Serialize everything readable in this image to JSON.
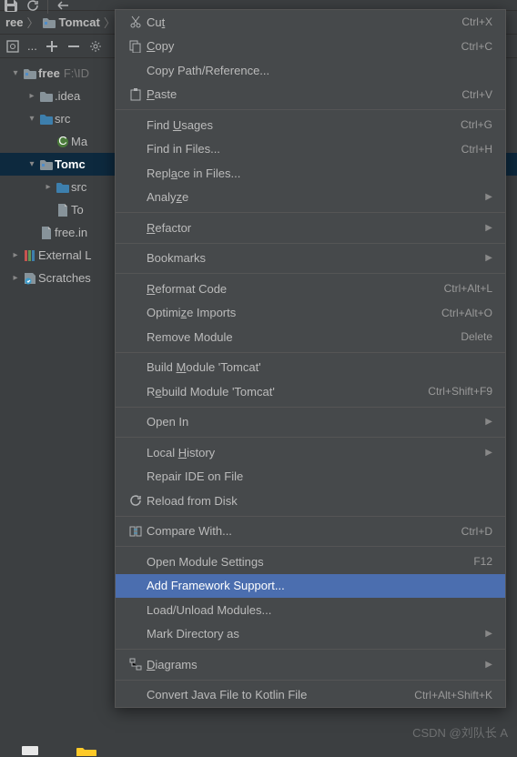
{
  "toolbar": {},
  "breadcrumb": {
    "project": "ree",
    "folder": "Tomcat",
    "sep": "〉"
  },
  "sideToolbar": {
    "label": "..."
  },
  "tree": {
    "free": {
      "name": "free",
      "path": "F:\\ID"
    },
    "idea": {
      "name": ".idea"
    },
    "src": {
      "name": "src"
    },
    "ma": {
      "name": "Ma"
    },
    "tomcat": {
      "name": "Tomc"
    },
    "srcin": {
      "name": "src"
    },
    "to": {
      "name": "To"
    },
    "freein": {
      "name": "free.in"
    },
    "ext": {
      "name": "External L"
    },
    "scratches": {
      "name": "Scratches"
    }
  },
  "menu": {
    "cut": {
      "label": "Cut",
      "shortcut": "Ctrl+X"
    },
    "copy": {
      "label": "Copy",
      "shortcut": "Ctrl+C"
    },
    "copypath": {
      "label": "Copy Path/Reference..."
    },
    "paste": {
      "label": "Paste",
      "shortcut": "Ctrl+V"
    },
    "findusages": {
      "label": "Find Usages",
      "shortcut": "Ctrl+G"
    },
    "findinfiles": {
      "label": "Find in Files...",
      "shortcut": "Ctrl+H"
    },
    "replace": {
      "label": "Replace in Files..."
    },
    "analyze": {
      "label": "Analyze"
    },
    "refactor": {
      "label": "Refactor"
    },
    "bookmarks": {
      "label": "Bookmarks"
    },
    "reformat": {
      "label": "Reformat Code",
      "shortcut": "Ctrl+Alt+L"
    },
    "optimize": {
      "label": "Optimize Imports",
      "shortcut": "Ctrl+Alt+O"
    },
    "removemod": {
      "label": "Remove Module",
      "shortcut": "Delete"
    },
    "buildmod": {
      "label": "Build Module 'Tomcat'"
    },
    "rebuildmod": {
      "label": "Rebuild Module 'Tomcat'",
      "shortcut": "Ctrl+Shift+F9"
    },
    "openin": {
      "label": "Open In"
    },
    "localhist": {
      "label": "Local History"
    },
    "repairide": {
      "label": "Repair IDE on File"
    },
    "reload": {
      "label": "Reload from Disk"
    },
    "compare": {
      "label": "Compare With...",
      "shortcut": "Ctrl+D"
    },
    "openmodset": {
      "label": "Open Module Settings",
      "shortcut": "F12"
    },
    "addframework": {
      "label": "Add Framework Support..."
    },
    "loadunload": {
      "label": "Load/Unload Modules..."
    },
    "markdir": {
      "label": "Mark Directory as"
    },
    "diagrams": {
      "label": "Diagrams"
    },
    "convertkotlin": {
      "label": "Convert Java File to Kotlin File",
      "shortcut": "Ctrl+Alt+Shift+K"
    }
  },
  "watermark": "CSDN @刘队长 A"
}
